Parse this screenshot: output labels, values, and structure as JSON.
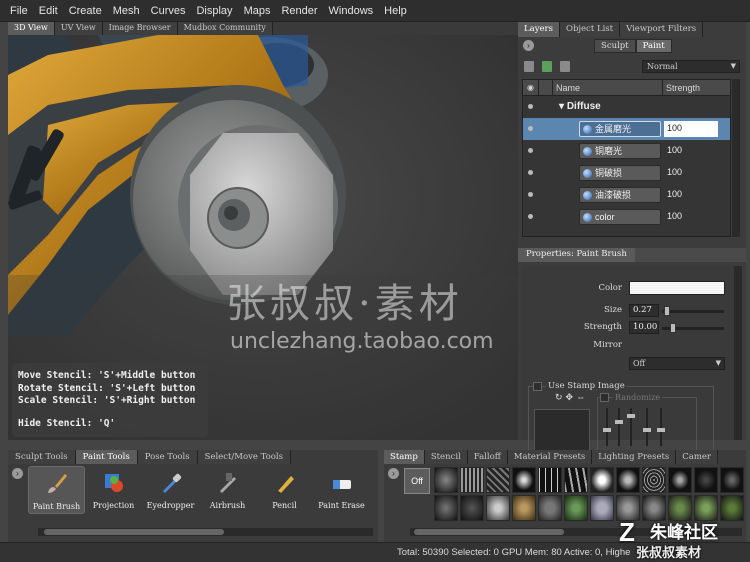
{
  "menu": [
    "File",
    "Edit",
    "Create",
    "Mesh",
    "Curves",
    "Display",
    "Maps",
    "Render",
    "Windows",
    "Help"
  ],
  "viewport_tabs": [
    "3D View",
    "UV View",
    "Image Browser",
    "Mudbox Community"
  ],
  "watermark": {
    "cn": "张叔叔·素材",
    "url": "unclezhang.taobao.com"
  },
  "stencil_help": {
    "move": "Move Stencil: 'S'+Middle button",
    "rotate": "Rotate Stencil: 'S'+Left button",
    "scale": "Scale Stencil: 'S'+Right button",
    "hide": "Hide Stencil: 'Q'"
  },
  "right_tabs": [
    "Layers",
    "Object List",
    "Viewport Filters"
  ],
  "mode_tabs": {
    "sculpt": "Sculpt",
    "paint": "Paint"
  },
  "blend_mode": "Normal",
  "layers": {
    "col_name": "Name",
    "col_strength": "Strength",
    "group": "Diffuse",
    "rows": [
      {
        "name": "金属磨光",
        "strength": "100"
      },
      {
        "name": "铜磨光",
        "strength": "100"
      },
      {
        "name": "铜破损",
        "strength": "100"
      },
      {
        "name": "油漆破损",
        "strength": "100"
      },
      {
        "name": "color",
        "strength": "100"
      }
    ]
  },
  "properties": {
    "title": "Properties: Paint Brush",
    "color_label": "Color",
    "color_value": "#f5f5f5",
    "size_label": "Size",
    "size_value": "0.27",
    "strength_label": "Strength",
    "strength_value": "10.00",
    "mirror_label": "Mirror",
    "mirror_value": "Off",
    "use_stamp_label": "Use Stamp Image",
    "randomize_label": "Randomize"
  },
  "tool_tabs": [
    "Sculpt Tools",
    "Paint Tools",
    "Pose Tools",
    "Select/Move Tools"
  ],
  "tools": [
    {
      "label": "Paint Brush",
      "icon": "paint-brush-icon"
    },
    {
      "label": "Projection",
      "icon": "projection-icon"
    },
    {
      "label": "Eyedropper",
      "icon": "eyedropper-icon"
    },
    {
      "label": "Airbrush",
      "icon": "airbrush-icon"
    },
    {
      "label": "Pencil",
      "icon": "pencil-icon"
    },
    {
      "label": "Paint Erase",
      "icon": "eraser-icon"
    }
  ],
  "stamp_tabs": [
    "Stamp",
    "Stencil",
    "Falloff",
    "Material Presets",
    "Lighting Presets",
    "Camer"
  ],
  "stamp_off": "Off",
  "status": "Total: 50390  Selected: 0 GPU Mem: 80  Active: 0, Highe",
  "logo": {
    "z": "Z",
    "line1": "朱峰社区",
    "line2": "张叔叔素材"
  }
}
